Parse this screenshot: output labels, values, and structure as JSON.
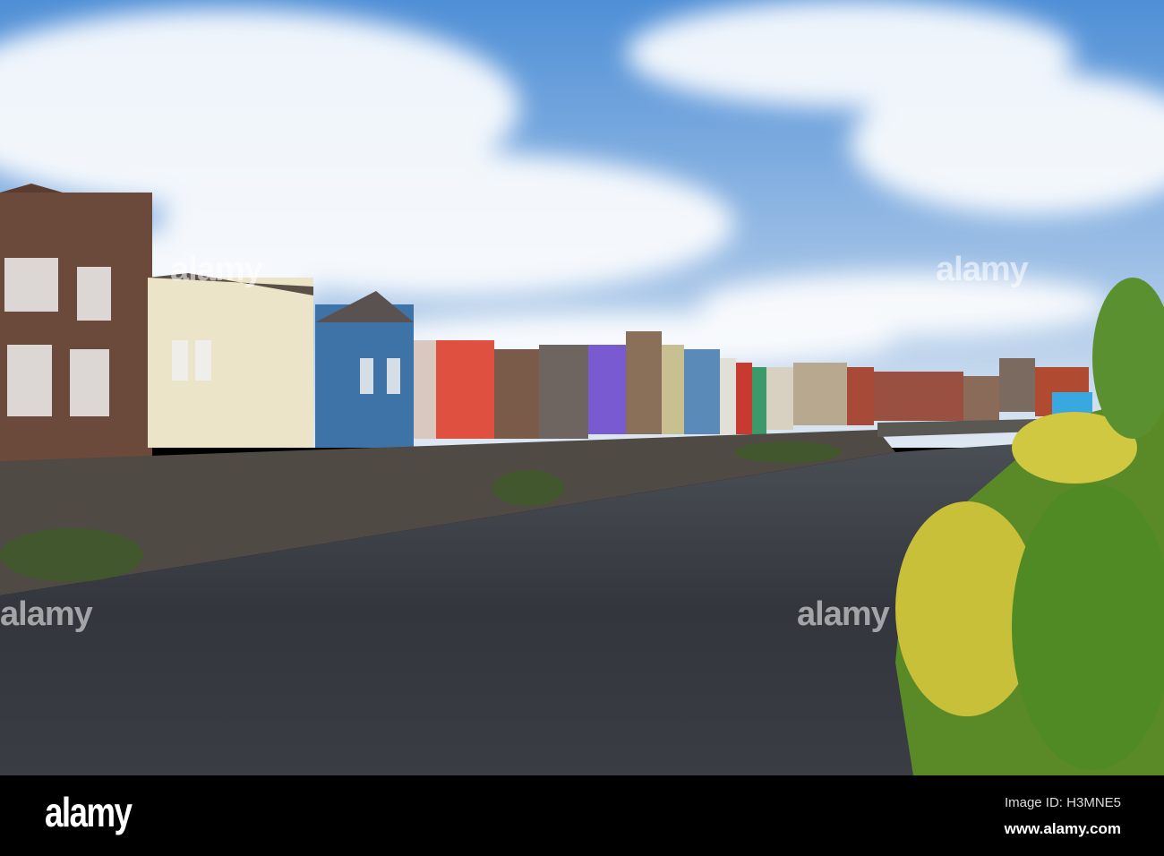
{
  "photo": {
    "colors": {
      "sky": "#5a97d6",
      "cloud": "#ffffff",
      "river": "#2f3138",
      "wall": "#4d4a44",
      "foliage": "#6a9a2a",
      "foliage_yellow": "#d8cc3a"
    }
  },
  "watermark": {
    "text": "alamy"
  },
  "footer": {
    "logo": "alamy",
    "image_id": "Image ID: H3MNE5",
    "website": "www.alamy.com"
  }
}
